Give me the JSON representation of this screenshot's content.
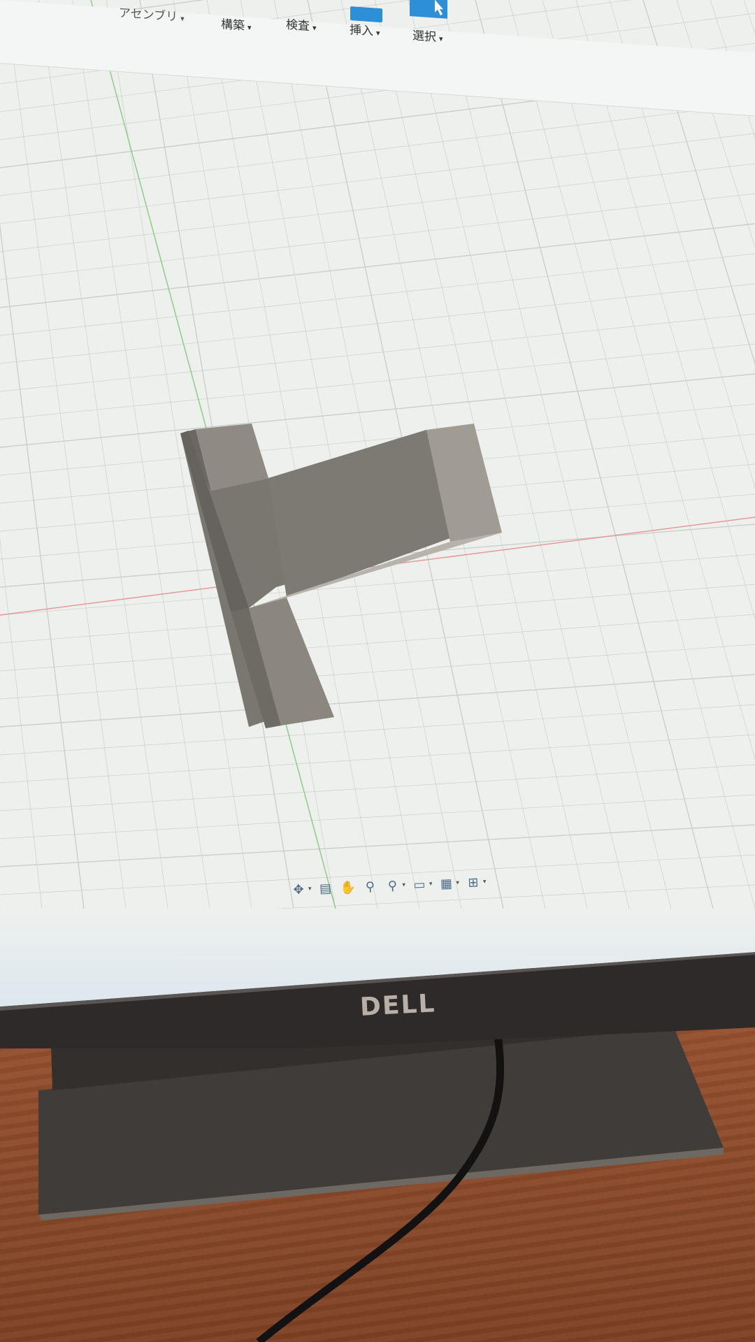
{
  "toolbar": {
    "items": [
      {
        "label": "アセンブリ",
        "caret": "▾"
      },
      {
        "label": "構築",
        "caret": "▾"
      },
      {
        "label": "検査",
        "caret": "▾"
      },
      {
        "label": "挿入",
        "caret": "▾"
      },
      {
        "label": "選択",
        "caret": "▾"
      }
    ]
  },
  "nav_bar": {
    "icons": [
      "orbit-icon",
      "look-at-icon",
      "pan-icon",
      "zoom-icon",
      "fit-icon",
      "display-settings-icon",
      "grid-settings-icon",
      "viewports-icon"
    ]
  },
  "monitor": {
    "brand": "DELL"
  },
  "colors": {
    "model_face": "#7d7a74",
    "model_side": "#9c9890",
    "grid_line": "#c9d0cc",
    "axis_x": "#e08a8a",
    "axis_y": "#7fc47a",
    "accent": "#2d8fd6"
  }
}
